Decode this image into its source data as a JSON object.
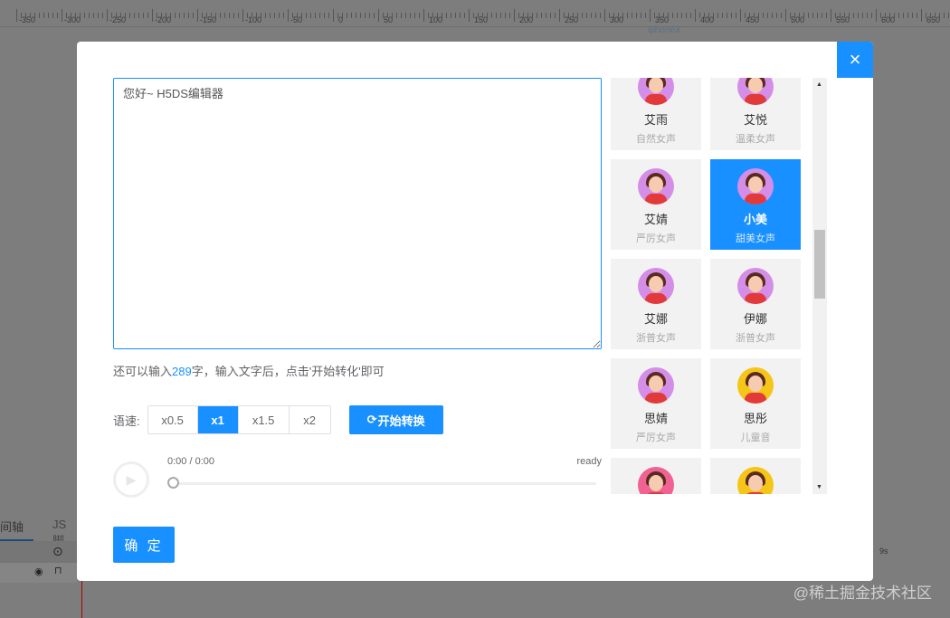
{
  "ruler": {
    "labels": [
      "-350",
      "-300",
      "-250",
      "-200",
      "-150",
      "-100",
      "-50",
      "0",
      "50",
      "100",
      "150",
      "200",
      "250",
      "300",
      "350",
      "400",
      "450",
      "500",
      "550",
      "600",
      "650"
    ],
    "device": "iphoneX"
  },
  "background": {
    "tab_timeline": "间轴",
    "tab_js": "JS脚",
    "time_mark": "9s",
    "watermark": "@稀土掘金技术社区"
  },
  "modal": {
    "close_icon": "×",
    "textarea_value": "您好~ H5DS编辑器",
    "hint_prefix": "还可以输入",
    "hint_count": "289",
    "hint_suffix": "字，输入文字后，点击'开始转化'即可",
    "speed_label": "语速:",
    "speeds": [
      {
        "label": "x0.5",
        "active": false
      },
      {
        "label": "x1",
        "active": true
      },
      {
        "label": "x1.5",
        "active": false
      },
      {
        "label": "x2",
        "active": false
      }
    ],
    "convert_label": "开始转换",
    "player": {
      "time": "0:00 / 0:00",
      "status": "ready",
      "progress": 0
    },
    "confirm_label": "确 定",
    "voices": [
      {
        "name": "艾雨",
        "desc": "自然女声",
        "avatar": "#d48ee8",
        "selected": false
      },
      {
        "name": "艾悦",
        "desc": "温柔女声",
        "avatar": "#d48ee8",
        "selected": false
      },
      {
        "name": "艾婧",
        "desc": "严厉女声",
        "avatar": "#d48ee8",
        "selected": false
      },
      {
        "name": "小美",
        "desc": "甜美女声",
        "avatar": "#d48ee8",
        "selected": true
      },
      {
        "name": "艾娜",
        "desc": "浙普女声",
        "avatar": "#d48ee8",
        "selected": false
      },
      {
        "name": "伊娜",
        "desc": "浙普女声",
        "avatar": "#d48ee8",
        "selected": false
      },
      {
        "name": "思婧",
        "desc": "严厉女声",
        "avatar": "#d48ee8",
        "selected": false
      },
      {
        "name": "思彤",
        "desc": "儿童音",
        "avatar": "#f5c518",
        "selected": false
      },
      {
        "name": "",
        "desc": "",
        "avatar": "#f06292",
        "selected": false
      },
      {
        "name": "",
        "desc": "",
        "avatar": "#f5c518",
        "selected": false
      }
    ]
  },
  "colors": {
    "accent": "#1890ff"
  }
}
